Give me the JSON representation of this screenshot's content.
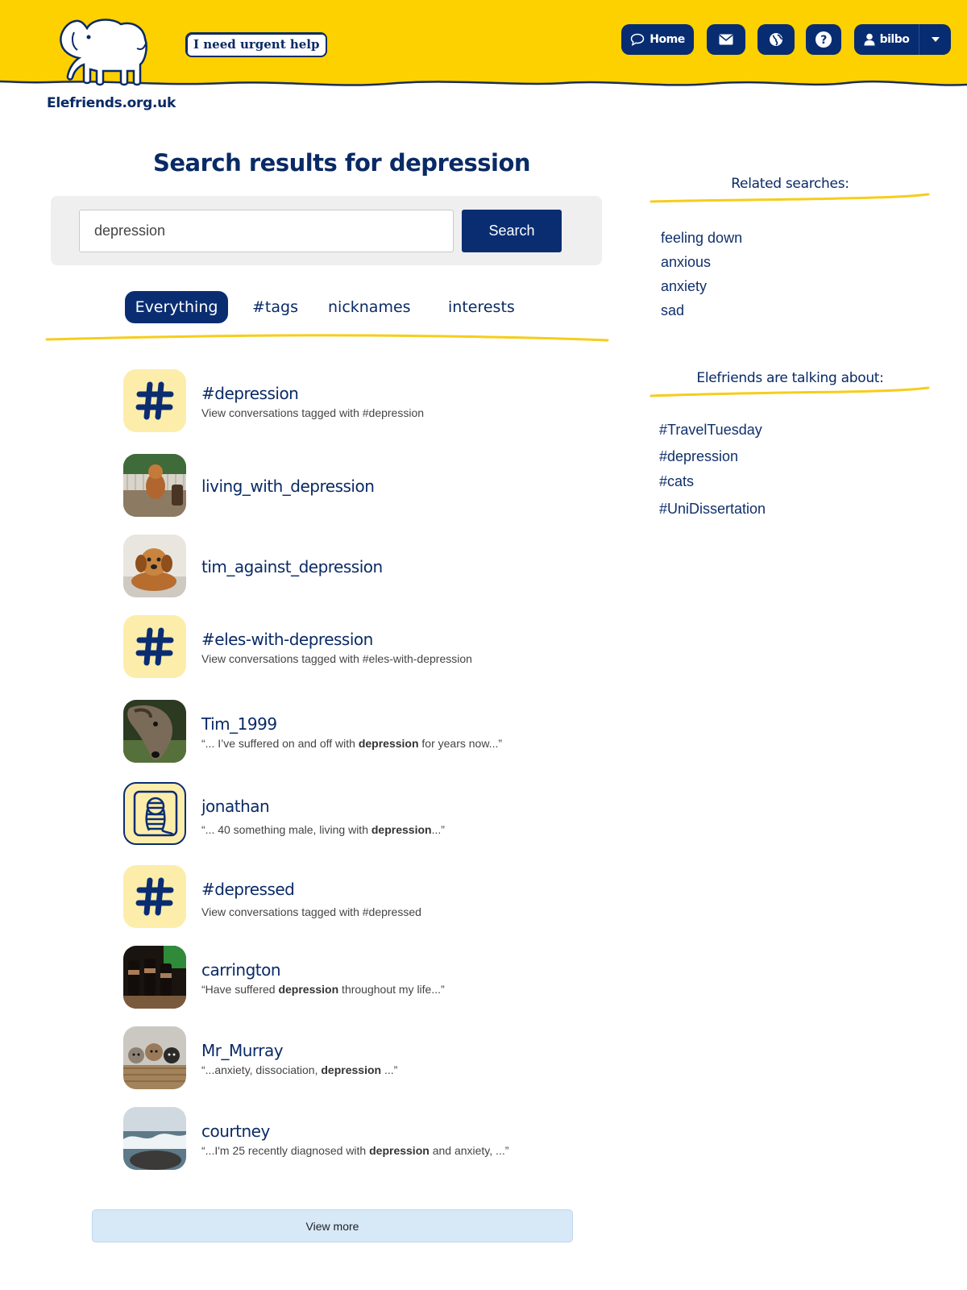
{
  "header": {
    "urgent_help": "I need urgent help",
    "brand": "Elefriends.org.uk",
    "nav": {
      "home_label": "Home",
      "user_label": "bilbo"
    },
    "colors": {
      "band": "#fdd000",
      "button": "#082c71"
    }
  },
  "search": {
    "title": "Search results for depression",
    "input_value": "depression",
    "button_label": "Search",
    "tabs": [
      "Everything",
      "#tags",
      "nicknames",
      "interests"
    ],
    "active_tab": "Everything"
  },
  "results": [
    {
      "title": "#depression",
      "subtitle": "View conversations tagged with #depression",
      "avatar": "hash-icon"
    },
    {
      "title": "living_with_depression",
      "subtitle": "",
      "avatar": "dog-photo"
    },
    {
      "title": "tim_against_depression",
      "subtitle": "",
      "avatar": "puppy-photo"
    },
    {
      "title": "#eles-with-depression",
      "subtitle": "View conversations tagged with #eles-with-depression",
      "avatar": "hash-icon"
    },
    {
      "title": "Tim_1999",
      "sub_pre": "“... I’ve suffered on and off with ",
      "sub_bold": "depression",
      "sub_post": " for years now...”",
      "avatar": "greyhound-photo"
    },
    {
      "title": "jonathan",
      "sub_pre": "“... 40 something male, living with ",
      "sub_bold": "depression",
      "sub_post": "...”",
      "avatar": "doodle-avatar"
    },
    {
      "title": "#depressed",
      "subtitle": "View conversations tagged with #depressed",
      "avatar": "hash-icon"
    },
    {
      "title": "carrington",
      "sub_pre": "“Have suffered ",
      "sub_bold": "depression",
      "sub_post": " throughout my life...”",
      "avatar": "bottles-photo"
    },
    {
      "title": "Mr_Murray",
      "sub_pre": "“...anxiety, dissociation, ",
      "sub_bold": "depression",
      "sub_post": " ...”",
      "avatar": "kittens-photo"
    },
    {
      "title": "courtney",
      "sub_pre": "“...I'm 25 recently diagnosed with ",
      "sub_bold": "depression",
      "sub_post": " and anxiety, ...”",
      "avatar": "waves-photo"
    }
  ],
  "view_more": "View more",
  "sidebar": {
    "related_title": "Related searches:",
    "related": [
      "feeling down",
      "anxious",
      "anxiety",
      "sad"
    ],
    "talking_title": "Elefriends are talking about:",
    "talking": [
      "#TravelTuesday",
      "#depression",
      "#cats",
      "#UniDissertation"
    ]
  }
}
